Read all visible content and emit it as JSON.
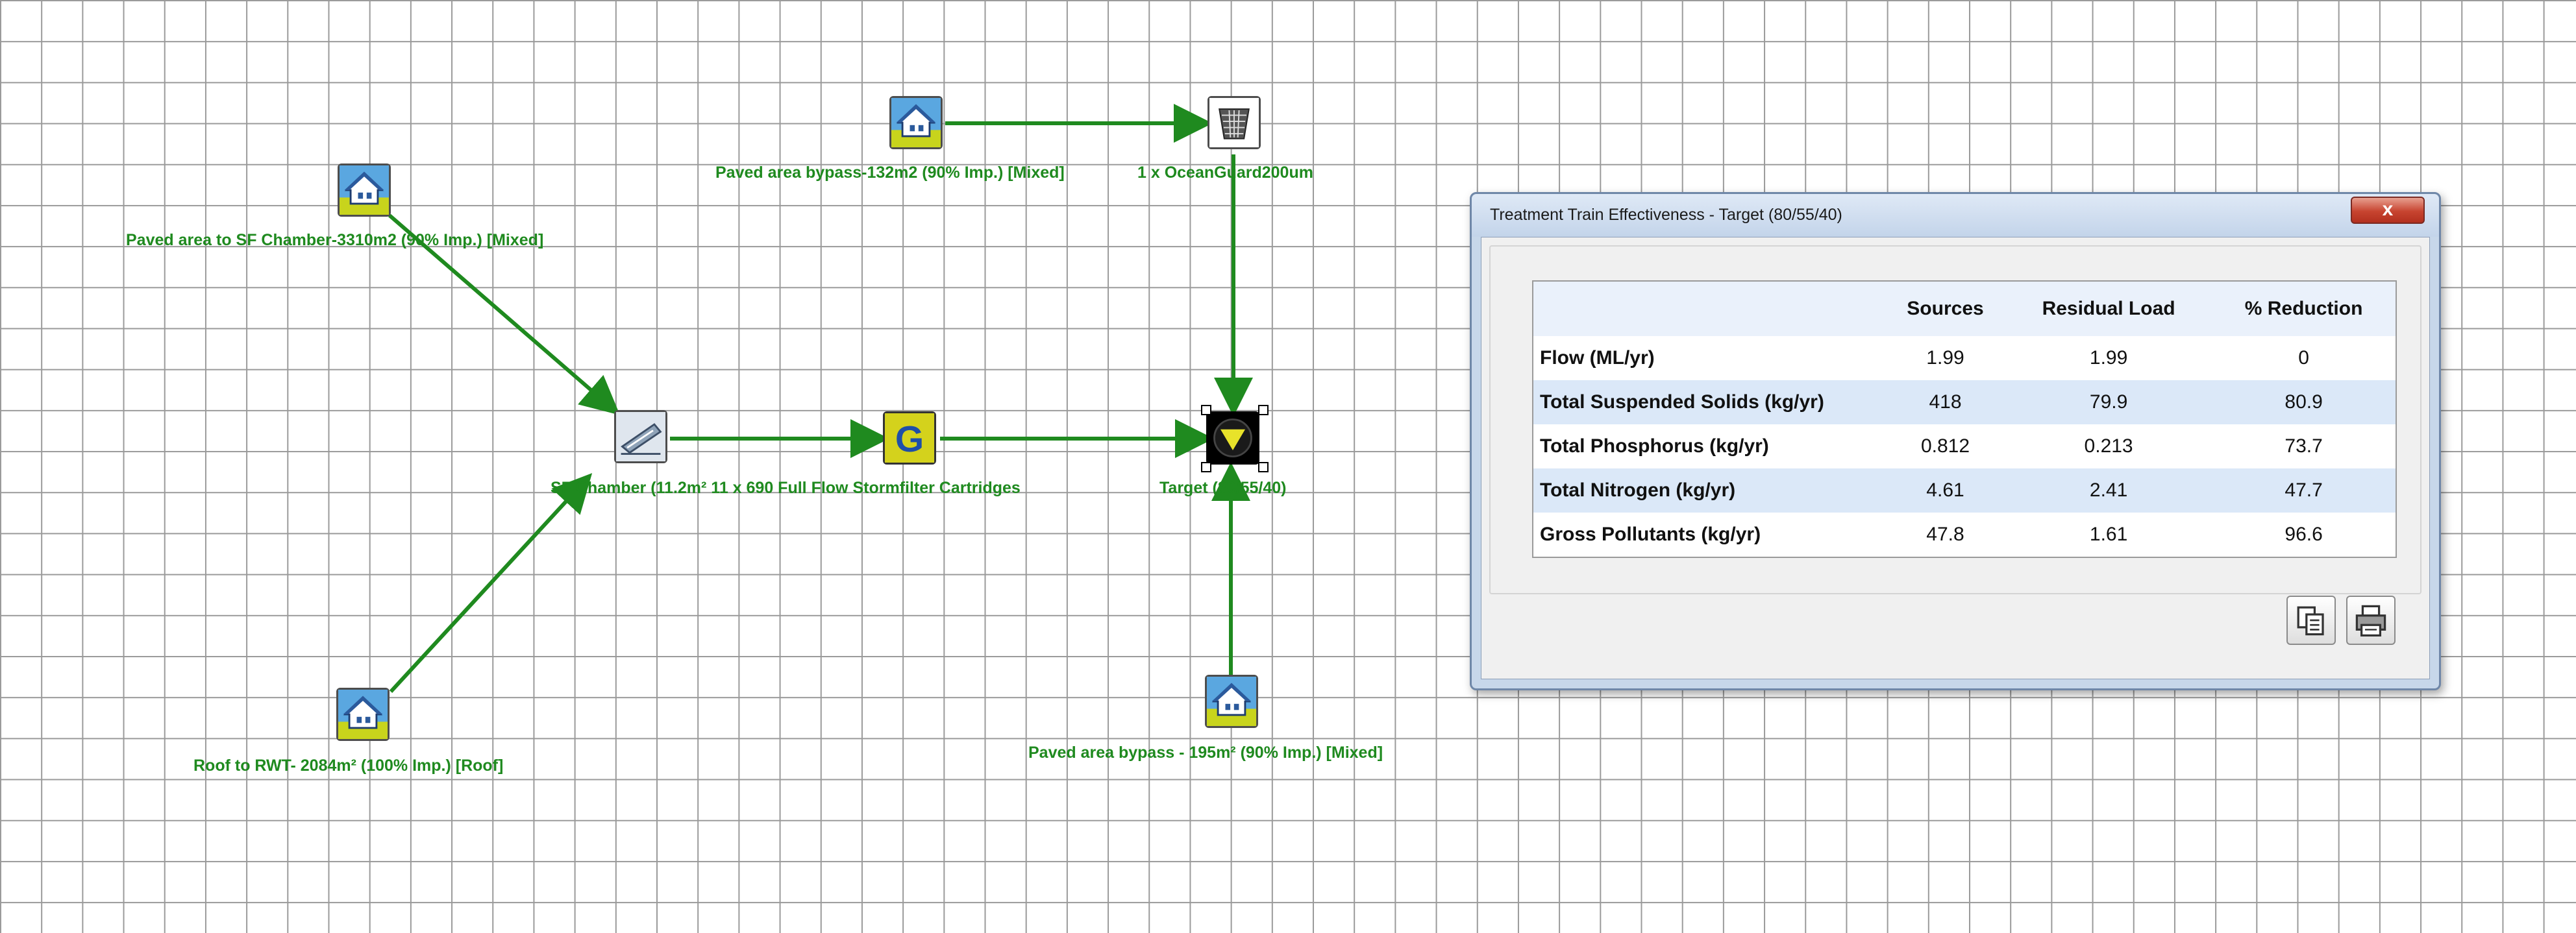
{
  "canvas": {
    "nodes": {
      "paved_sf": {
        "label": "Paved area to SF Chamber-3310m2 (90% Imp.) [Mixed]",
        "icon": "house-icon"
      },
      "paved_bypass_132": {
        "label": "Paved area bypass-132m2 (90% Imp.) [Mixed]",
        "icon": "house-icon"
      },
      "oceanguard": {
        "label": "1 x OceanGuard200um",
        "icon": "filter-basket-icon"
      },
      "sf_chamber": {
        "label": "SF Chamber (11.2m² 11 x 690 Full Flow Stormfilter Cartridges",
        "icon": "sedimentation-chamber-icon"
      },
      "generic": {
        "label": "G",
        "icon": "generic-treatment-icon"
      },
      "target": {
        "label": "Target (80/55/40)",
        "icon": "target-node-icon"
      },
      "roof_rwt": {
        "label": "Roof to RWT- 2084m² (100% Imp.) [Roof]",
        "icon": "house-icon"
      },
      "paved_bypass_195": {
        "label": "Paved area bypass - 195m² (90% Imp.) [Mixed]",
        "icon": "house-icon"
      }
    },
    "link_color": "#1f8a1f"
  },
  "dialog": {
    "title": "Treatment Train Effectiveness - Target (80/55/40)",
    "close_label": "x",
    "table": {
      "headers": [
        "",
        "Sources",
        "Residual Load",
        "% Reduction"
      ],
      "rows": [
        {
          "label": "Flow (ML/yr)",
          "sources": "1.99",
          "residual": "1.99",
          "reduction": "0"
        },
        {
          "label": "Total Suspended Solids (kg/yr)",
          "sources": "418",
          "residual": "79.9",
          "reduction": "80.9"
        },
        {
          "label": "Total Phosphorus (kg/yr)",
          "sources": "0.812",
          "residual": "0.213",
          "reduction": "73.7"
        },
        {
          "label": "Total Nitrogen (kg/yr)",
          "sources": "4.61",
          "residual": "2.41",
          "reduction": "47.7"
        },
        {
          "label": "Gross Pollutants (kg/yr)",
          "sources": "47.8",
          "residual": "1.61",
          "reduction": "96.6"
        }
      ]
    },
    "buttons": {
      "copy_icon": "copy-icon",
      "print_icon": "printer-icon"
    }
  }
}
